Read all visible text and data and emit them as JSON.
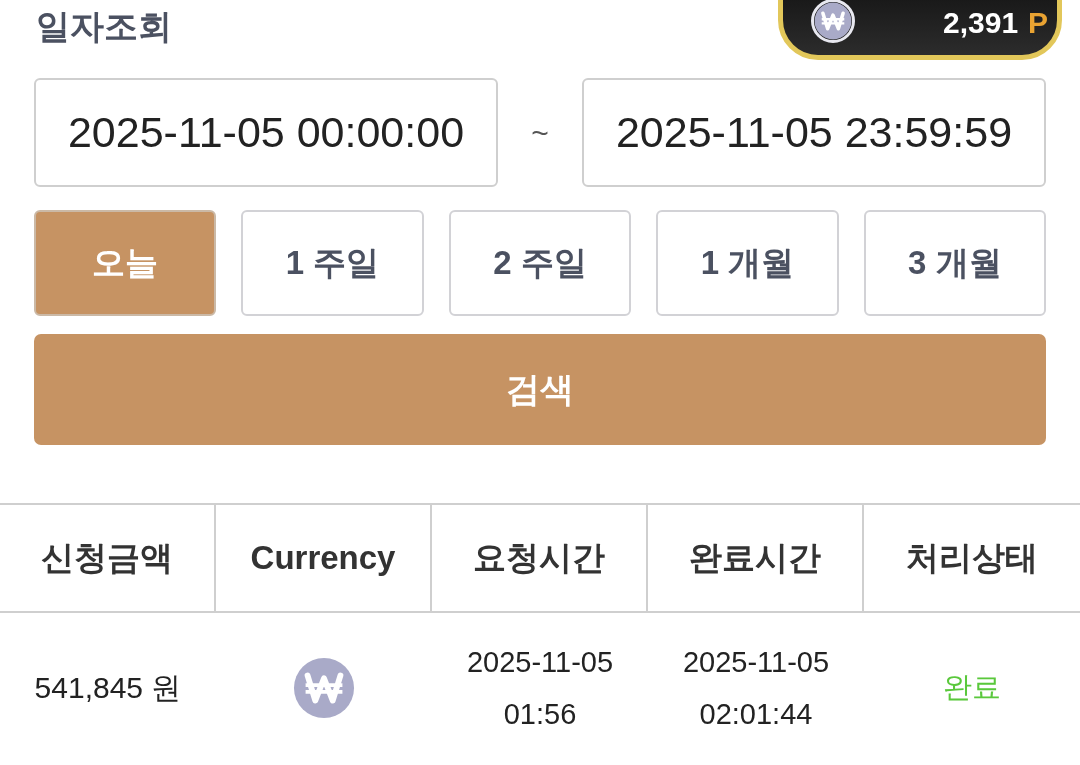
{
  "balance": {
    "amount": "2,391",
    "unit": "P"
  },
  "title": "일자조회",
  "date_range": {
    "start": "2025-11-05 00:00:00",
    "separator": "~",
    "end": "2025-11-05 23:59:59"
  },
  "periods": [
    {
      "label": "오늘",
      "selected": true
    },
    {
      "label": "1 주일",
      "selected": false
    },
    {
      "label": "2 주일",
      "selected": false
    },
    {
      "label": "1 개월",
      "selected": false
    },
    {
      "label": "3 개월",
      "selected": false
    }
  ],
  "search_button": "검색",
  "table": {
    "columns": [
      "신청금액",
      "Currency",
      "요청시간",
      "완료시간",
      "처리상태"
    ],
    "rows": [
      {
        "amount": "541,845 원",
        "requested": "2025-11-05 01:56",
        "completed": "2025-11-05 02:01:44",
        "status": "완료"
      }
    ]
  }
}
